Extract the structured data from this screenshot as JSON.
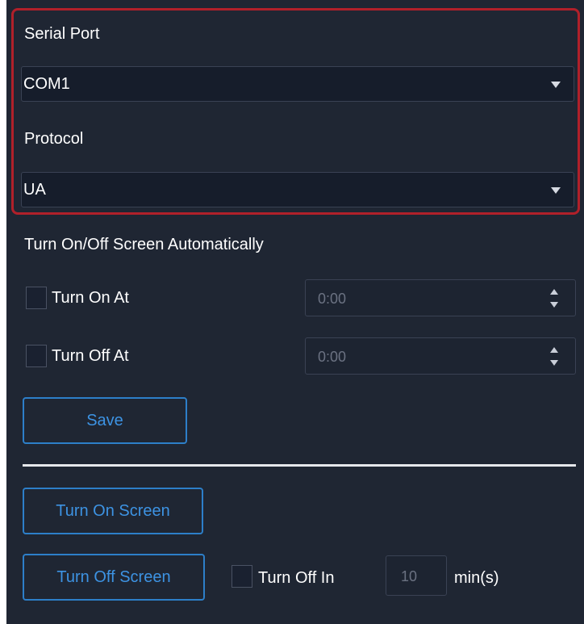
{
  "serial_port": {
    "label": "Serial Port",
    "selected": "COM1"
  },
  "protocol": {
    "label": "Protocol",
    "selected": "UA"
  },
  "auto_screen": {
    "heading": "Turn On/Off Screen Automatically",
    "turn_on_label": "Turn On At",
    "turn_on_time": "0:00",
    "turn_off_label": "Turn Off At",
    "turn_off_time": "0:00",
    "save_label": "Save"
  },
  "manual_screen": {
    "turn_on_button": "Turn On Screen",
    "turn_off_button": "Turn Off Screen",
    "turn_off_in_label": "Turn Off In",
    "turn_off_in_value": "10",
    "unit": "min(s)"
  },
  "colors": {
    "panel_bg": "#1f2633",
    "highlight_border": "#b0202a",
    "accent_blue": "#2d7fc9"
  }
}
